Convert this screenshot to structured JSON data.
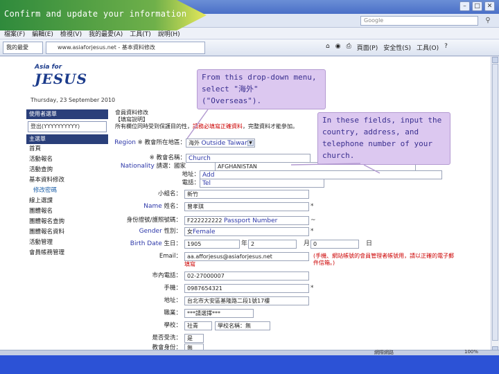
{
  "slide": {
    "title": "Confirm and update your information",
    "callout_dropdown": "From this drop-down menu, select \"海外\" (\"Overseas\").",
    "callout_fields": "In these fields, input the country, address, and telephone number of your church."
  },
  "browser": {
    "search_placeholder": "Google",
    "menu": [
      "檔案(F)",
      "編輯(E)",
      "檢視(V)",
      "我的最愛(A)",
      "工具(T)",
      "說明(H)"
    ],
    "tab_label": "我的最愛",
    "tab_title": "www.asiaforjesus.net - 基本資料修改",
    "toolbar": [
      "頁面(P)",
      "安全性(S)",
      "工具(O)"
    ]
  },
  "site": {
    "logo_top": "Asia for",
    "logo_main": "JESUS",
    "date": "Thursday, 23 September 2010"
  },
  "sidebar": {
    "user_header": "使用者選單",
    "user_box": "登出(YYYYYYYYYY)",
    "main_header": "主選單",
    "items": [
      "首頁",
      "活動報名",
      "活動查詢",
      "基本資料修改"
    ],
    "active_item": "修改密碼",
    "items2": [
      "線上選課",
      "團體報名",
      "團體報名查詢",
      "團體報名資料",
      "活動管理",
      "會員帳務管理"
    ]
  },
  "form_intro": {
    "line1": "會員資料修改",
    "line2": "【填寫說明】",
    "line3_start": "所有欄位同時受到保護目的性，",
    "line3_red": "請務必填寫正確資料",
    "line3_end": "，完整資料才能參加。"
  },
  "labels": {
    "region_en": "Region",
    "region_zh": "※ 教會所在地區：",
    "church_en": "Church",
    "church_zh": "※ 教會名稱：",
    "nationality_en": "Nationality",
    "church_country_zh": "請選：國家",
    "address_zh": "地址：",
    "address_en": "Add",
    "phone_zh": "電話：",
    "phone_en": "Tel",
    "group_zh": "小組名：",
    "name_en": "Name",
    "name_zh": "姓名：",
    "passport_zh": "身份證號/護照號碼：",
    "gender_en": "Gender",
    "gender_zh": "性別：",
    "birth_en": "Birth Date",
    "birth_zh": "生日：",
    "email_zh": "Email：",
    "home_phone_zh": "市內電話：",
    "mobile_zh": "手機：",
    "home_address_zh": "地址：",
    "job_zh": "職業：",
    "school_zh": "學校：",
    "baptized_zh": "是否受洗：",
    "role_zh": "教會身份："
  },
  "values": {
    "region_zh": "海外",
    "region_en": "Outside Taiwan",
    "church_value": "Church",
    "country_select": "AFGHANISTAN",
    "group_value": "新竹",
    "name_value": "曾孝琪",
    "passport_value": "F222222222",
    "passport_en": "Passport Number",
    "gender_value": "女",
    "gender_en": "Female",
    "birth_year": "1905",
    "birth_year_unit": "年",
    "birth_month": "2",
    "birth_month_unit": "月",
    "birth_day": "0",
    "birth_day_unit": "日",
    "email_value": "aa.afforjesus@asiaforjesus.net",
    "email_note": "(手機、網站帳號的會員管理者帳號用，請以正確的電子郵件信箱。)",
    "email_note2": "填寫",
    "home_phone_value": "02-27000007",
    "mobile_value": "0987654321",
    "home_address_value": "台北市大安區基隆路二段1號17樓",
    "job_value": "***請選擇***",
    "school_value": "社青",
    "school_extra": "學校名稱：無",
    "baptized_value": "是",
    "role_value": "無"
  },
  "status": {
    "left": "網際網路",
    "right": "100%"
  },
  "colors": {
    "callout_bg": "#dcc8f0",
    "callout_text": "#3a2f8f",
    "title_bg": "#2f8a3c",
    "english_label": "#2b36a8"
  }
}
